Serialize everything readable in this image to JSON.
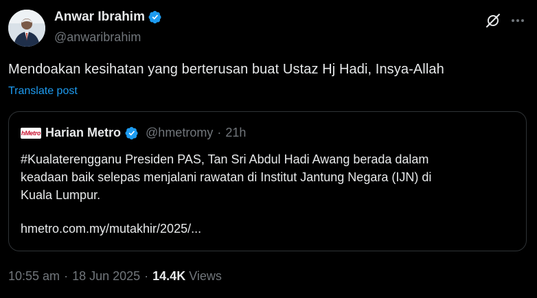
{
  "colors": {
    "background": "#000000",
    "text": "#e7e9ea",
    "secondary_text": "#71767b",
    "link": "#1d9bf0",
    "border": "#2f3336",
    "verified_badge": "#1d9bf0"
  },
  "author": {
    "display_name": "Anwar Ibrahim",
    "handle": "@anwaribrahim",
    "verified": true,
    "avatar_icon": "profile-photo"
  },
  "header_actions": {
    "grok_icon": "grok-icon",
    "more_icon": "more-dots-icon"
  },
  "post": {
    "text": "Mendoakan kesihatan yang berterusan buat Ustaz Hj Hadi, Insya-Allah",
    "translate_label": "Translate post"
  },
  "quote": {
    "logo_text": "hMetro",
    "display_name": "Harian Metro",
    "handle": "@hmetromy",
    "separator": "·",
    "time": "21h",
    "text_lines": [
      "#Kualaterengganu Presiden PAS, Tan Sri Abdul Hadi Awang berada dalam",
      "keadaan baik selepas menjalani rawatan di Institut Jantung Negara (IJN) di",
      "Kuala Lumpur."
    ],
    "link": "hmetro.com.my/mutakhir/2025/..."
  },
  "meta": {
    "time": "10:55 am",
    "separator": "·",
    "date": "18 Jun 2025",
    "views_count": "14.4K",
    "views_label": "Views"
  }
}
